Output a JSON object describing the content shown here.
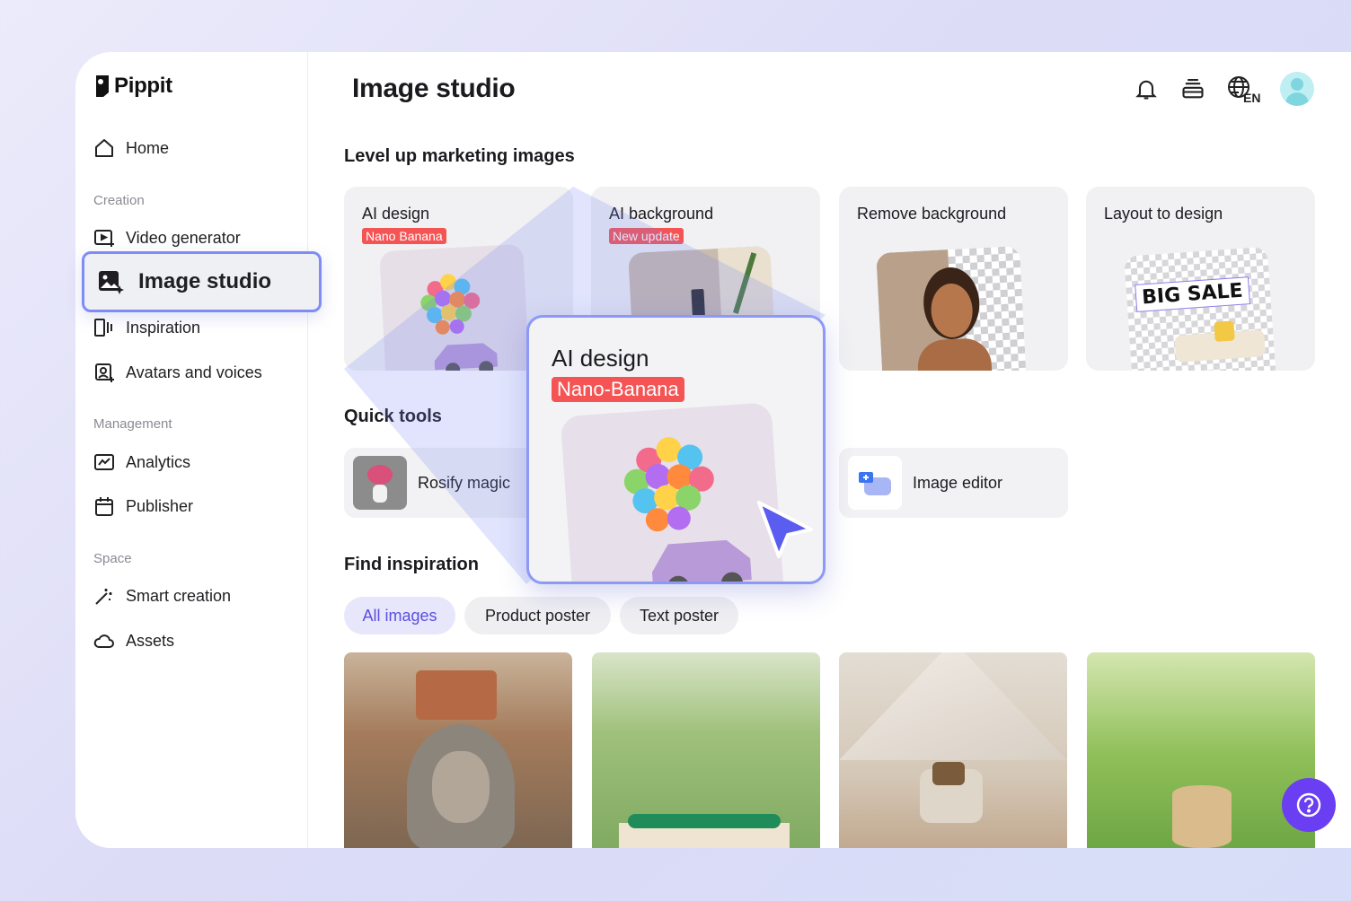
{
  "app": {
    "name": "Pippit"
  },
  "sidebar": {
    "home": "Home",
    "sections": [
      {
        "label": "Creation"
      },
      {
        "label": "Management"
      },
      {
        "label": "Space"
      }
    ],
    "items": {
      "video_generator": "Video generator",
      "image_studio": "Image studio",
      "inspiration": "Inspiration",
      "avatars_voices": "Avatars and voices",
      "analytics": "Analytics",
      "publisher": "Publisher",
      "smart_creation": "Smart creation",
      "assets": "Assets"
    }
  },
  "header": {
    "title": "Image studio",
    "language": "EN",
    "icons": [
      "bell-icon",
      "stack-icon",
      "globe-icon",
      "avatar"
    ]
  },
  "marketing": {
    "title": "Level up marketing images",
    "cards": [
      {
        "title": "AI design",
        "badge": "Nano Banana"
      },
      {
        "title": "AI background",
        "badge": "New update"
      },
      {
        "title": "Remove background"
      },
      {
        "title": "Layout to design",
        "thumb_text": "BIG SALE"
      }
    ]
  },
  "quick_tools": {
    "title": "Quick tools",
    "items": [
      {
        "label": "Rosify magic"
      },
      {
        "label": "Image editor"
      }
    ]
  },
  "inspiration": {
    "title": "Find inspiration",
    "filters": [
      "All images",
      "Product poster",
      "Text poster"
    ],
    "active_filter": "All images"
  },
  "zoom_card": {
    "title": "AI design",
    "badge": "Nano-Banana"
  },
  "colors": {
    "accent": "#6a3ef2",
    "badge": "#f55454",
    "highlight_border": "#7f8cf6"
  }
}
